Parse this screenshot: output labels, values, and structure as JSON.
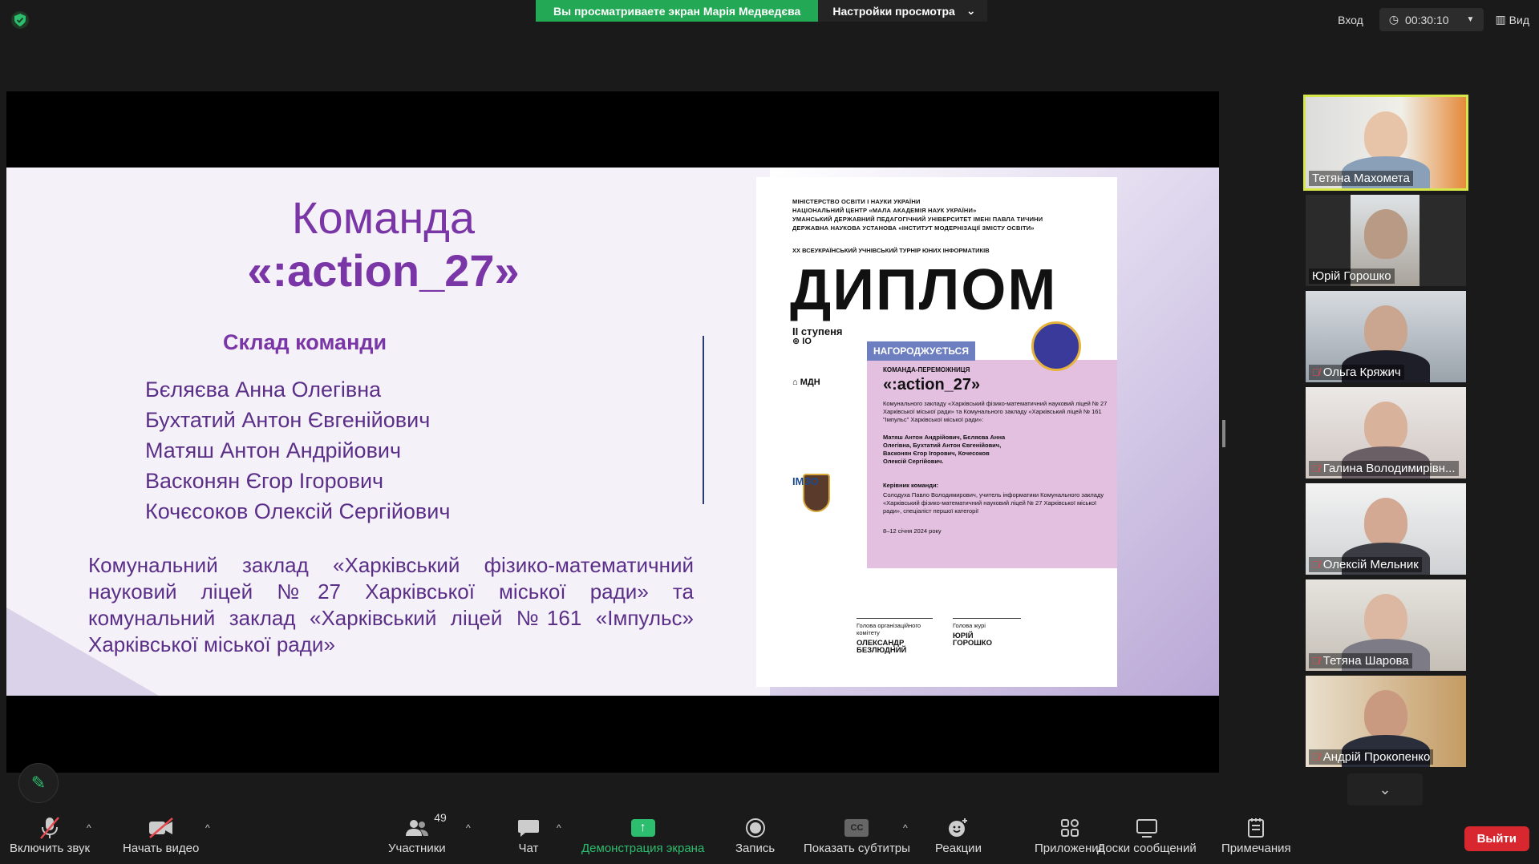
{
  "topbar": {
    "sharing_text": "Вы просматриваете экран Марія Медведєва",
    "view_settings": "Настройки просмотра",
    "enter": "Вход",
    "timer": "00:30:10",
    "view": "Вид"
  },
  "slide": {
    "title_line1": "Команда",
    "title_line2": "«:action_27»",
    "team_heading": "Склад команди",
    "members": [
      "Бєляєва Анна Олегівна",
      "Бухтатий Антон Євгенійович",
      "Матяш Антон Андрійович",
      "Васконян Єгор Ігорович",
      "Кочєсоков Олексій Сергійович"
    ],
    "school": "Комунальний заклад «Харківський фізико-математичний науковий ліцей №27 Харківської міської ради» та комунальний заклад «Харківський ліцей №161 «Імпульс» Харківської міської ради»"
  },
  "diploma": {
    "org_lines": [
      "МІНІСТЕРСТВО ОСВІТИ І НАУКИ УКРАЇНИ",
      "НАЦІОНАЛЬНИЙ ЦЕНТР «МАЛА АКАДЕМІЯ НАУК УКРАЇНИ»",
      "УМАНСЬКИЙ ДЕРЖАВНИЙ ПЕДАГОГІЧНИЙ УНІВЕРСИТЕТ ІМЕНІ ПАВЛА ТИЧИНИ",
      "ДЕРЖАВНА НАУКОВА УСТАНОВА «ІНСТИТУТ МОДЕРНІЗАЦІЇ ЗМІСТУ ОСВІТИ»"
    ],
    "tournament": "XX ВСЕУКРАЇНСЬКИЙ УЧНІВСЬКИЙ ТУРНІР ЮНИХ ІНФОРМАТИКІВ",
    "title": "ДИПЛОМ",
    "degree": "ІІ ступеня",
    "awarded": "НАГОРОДЖУЄТЬСЯ",
    "winner": "КОМАНДА-ПЕРЕМОЖНИЦЯ",
    "team": "«:action_27»",
    "school_text": "Комунального закладу «Харківський фізико-математичний науковий ліцей № 27 Харківської міської ради» та Комунального закладу «Харківський ліцей № 161 \"Імпульс\" Харківської міської ради»:",
    "members_text": "Матяш Антон Андрійович, Бєляєва Анна Олегівна, Бухтатий Антон Євгенійович, Васконян Єгор Ігорович, Кочесоков Олексій Сергійович.",
    "leader_head": "Керівник команди:",
    "leader_text": "Солодуха Павло Володимирович, учитель інформатики Комунального закладу «Харківський фізико-математичний науковий ліцей № 27 Харківської міської ради», спеціаліст першої категорії",
    "date": "8–12 січня 2024 року",
    "logo_mizh": "МДН",
    "logo_imzo": "ІМЗО",
    "sign1_role": "Голова організаційного комітету",
    "sign1_name": "ОЛЕКСАНДР БЕЗЛЮДНИЙ",
    "sign2_role": "Голова журі",
    "sign2_name": "ЮРІЙ ГОРОШКО"
  },
  "participants": [
    {
      "name": "Тетяна Махомета",
      "muted": false
    },
    {
      "name": "Юрій Горошко",
      "muted": false
    },
    {
      "name": "Ольга Кряжич",
      "muted": true
    },
    {
      "name": "Галина Володимирівн...",
      "muted": true
    },
    {
      "name": "Олексій Мельник",
      "muted": true
    },
    {
      "name": "Тетяна Шарова",
      "muted": true
    },
    {
      "name": "Андрій Прокопенко",
      "muted": true
    }
  ],
  "toolbar": {
    "mic": "Включить звук",
    "video": "Начать видео",
    "participants": "Участники",
    "participants_count": "49",
    "chat": "Чат",
    "share": "Демонстрация экрана",
    "record": "Запись",
    "captions": "Показать субтитры",
    "captions_icon": "CC",
    "reactions": "Реакции",
    "apps": "Приложения",
    "whiteboards": "Доски сообщений",
    "notes": "Примечания",
    "exit": "Выйти"
  }
}
